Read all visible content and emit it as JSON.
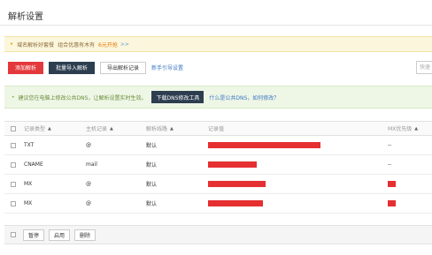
{
  "page": {
    "title": "解析设置"
  },
  "promo": {
    "prefix": "域名解析好套餐",
    "middle": "组合优惠有木有",
    "price": "6元开抢",
    "cta": ">>"
  },
  "toolbar": {
    "add_label": "添加解析",
    "import_label": "批量导入解析",
    "export_label": "导出解析记录",
    "guide_label": "新手引导设置",
    "search_placeholder": "快速"
  },
  "dns_tip": {
    "text": "建议您在电脑上修改公共DNS，让解析设置实时生效。",
    "tool_button": "下载DNS修改工具",
    "question": "什么是公共DNS，如何修改？"
  },
  "table": {
    "headers": {
      "type": "记录类型",
      "host": "主机记录",
      "line": "解析线路",
      "value": "记录值",
      "mx": "MX优先级"
    },
    "rows": [
      {
        "type": "TXT",
        "host": "@",
        "line": "默认",
        "mx": "--"
      },
      {
        "type": "CNAME",
        "host": "mail",
        "line": "默认",
        "mx": "--"
      },
      {
        "type": "MX",
        "host": "@",
        "line": "默认",
        "mx": ""
      },
      {
        "type": "MX",
        "host": "@",
        "line": "默认",
        "mx": ""
      }
    ]
  },
  "footer": {
    "pause_label": "暂停",
    "enable_label": "启用",
    "delete_label": "删除"
  },
  "colors": {
    "accent_red": "#e4393c",
    "dark_button": "#2d3e50",
    "link_blue": "#3c78c4",
    "redaction": "#e52f31"
  }
}
